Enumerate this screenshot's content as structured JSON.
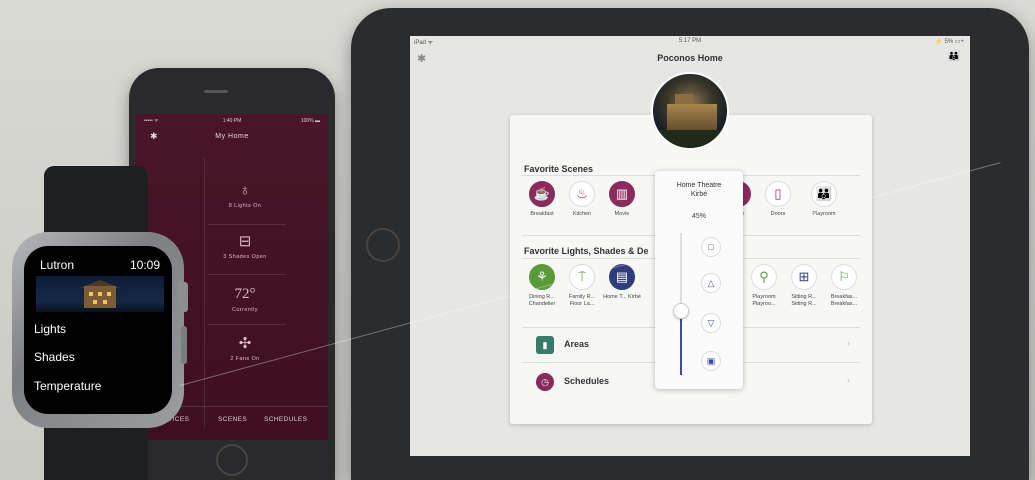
{
  "watch": {
    "app_title": "Lutron",
    "time": "10:09",
    "menu": [
      "Lights",
      "Shades",
      "Temperature"
    ]
  },
  "iphone": {
    "status": {
      "carrier": "••••• ᯤ",
      "time": "1:40 PM",
      "battery": "100% ▬"
    },
    "title": "My Home",
    "stats": [
      {
        "icon": "lightbulb-icon",
        "text": "8 Lights On"
      },
      {
        "icon": "shade-icon",
        "text": "3 Shades Open"
      },
      {
        "value": "72°",
        "text": "Currently"
      },
      {
        "icon": "fan-icon",
        "text": "2 Fans On"
      }
    ],
    "tabs": [
      "DEVICES",
      "SCENES",
      "SCHEDULES"
    ]
  },
  "ipad": {
    "status": {
      "left": "iPad ᯤ",
      "time": "5:17 PM",
      "right": "⚡ 5% ▭+"
    },
    "title": "Poconos Home",
    "favorite_scenes_title": "Favorite Scenes",
    "scenes": [
      {
        "label": "Breakfast",
        "icon": "coffee-icon",
        "filled": true
      },
      {
        "label": "Kitchen",
        "icon": "pot-icon",
        "filled": false
      },
      {
        "label": "Movie",
        "icon": "popcorn-icon",
        "filled": true
      },
      {
        "label": "Drive",
        "icon": "road-icon",
        "filled": true
      },
      {
        "label": "Doors",
        "icon": "door-icon",
        "filled": false
      },
      {
        "label": "Playroom",
        "icon": "people-icon",
        "filled": false
      }
    ],
    "favorite_devices_title": "Favorite Lights, Shades & De",
    "devices": [
      {
        "label": "Dining R... Chandelier",
        "icon": "chandelier-icon"
      },
      {
        "label": "Family R... Floor La...",
        "icon": "floor-lamp-icon"
      },
      {
        "label": "Home T... Kirbé",
        "icon": "shade-icon"
      },
      {
        "label": "Playroom Playroo...",
        "icon": "pendant-icon"
      },
      {
        "label": "Sitting R... Sitting R...",
        "icon": "window-icon"
      },
      {
        "label": "Breakfas... Breakfas...",
        "icon": "lamp-icon"
      }
    ],
    "list": [
      {
        "label": "Areas",
        "icon": "areas-icon",
        "color": "#3a7a6a"
      },
      {
        "label": "Schedules",
        "icon": "clock-icon",
        "color": "#8a2b5d"
      }
    ],
    "popup": {
      "title_line1": "Home Theatre",
      "title_line2": "Kirbé",
      "level_text": "45%",
      "level": 0.45
    }
  }
}
